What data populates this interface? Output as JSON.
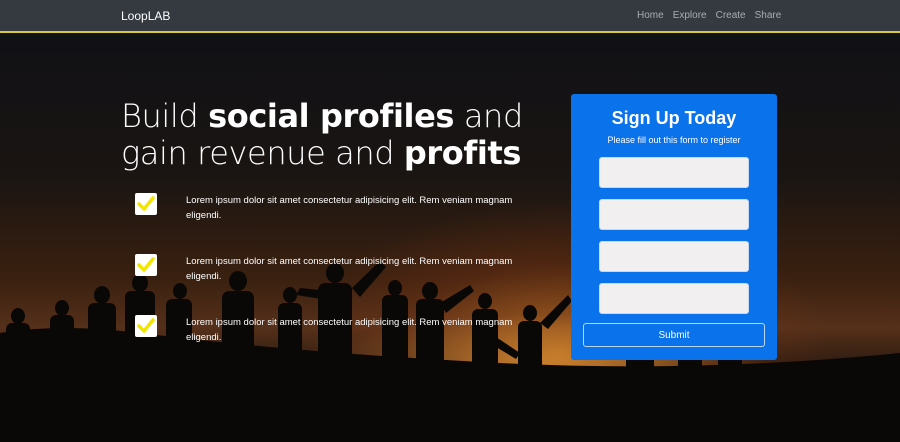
{
  "navbar": {
    "brand": "LoopLAB",
    "links": [
      "Home",
      "Explore",
      "Create",
      "Share"
    ]
  },
  "hero": {
    "headline": {
      "part1": "Build ",
      "bold1": "social profiles",
      "part2": " and gain revenue and ",
      "bold2": "profits"
    },
    "features": [
      "Lorem ipsum dolor sit amet consectetur adipisicing elit. Rem veniam magnam eligendi.",
      "Lorem ipsum dolor sit amet consectetur adipisicing elit. Rem veniam magnam eligendi.",
      "Lorem ipsum dolor sit amet consectetur adipisicing elit. Rem veniam magnam eligendi."
    ]
  },
  "signup": {
    "title": "Sign Up Today",
    "subtitle": "Please fill out this form to register",
    "fields": [
      "",
      "",
      "",
      ""
    ],
    "submit_label": "Submit"
  },
  "colors": {
    "navbar_bg": "#343a40",
    "navbar_accent": "#d8c93a",
    "card_bg": "#0a72ea",
    "check_color": "#f2e600"
  },
  "icons": {
    "check": "checkmark-icon"
  }
}
